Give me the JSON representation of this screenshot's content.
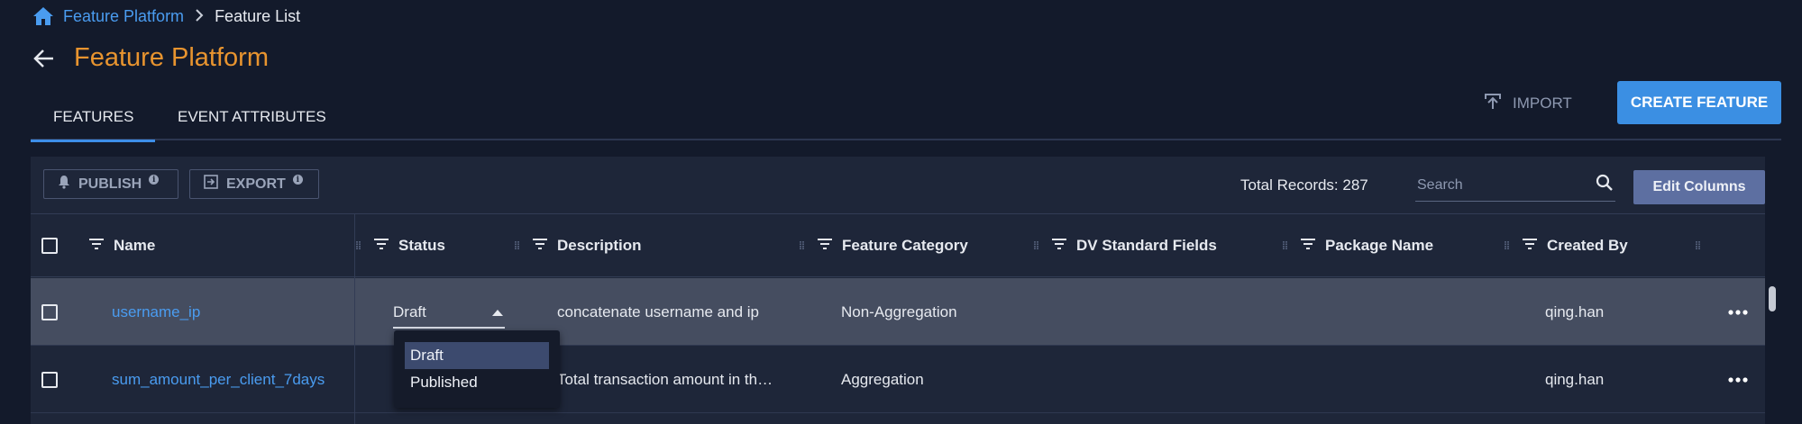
{
  "breadcrumb": {
    "root": "Feature Platform",
    "current": "Feature List"
  },
  "page": {
    "title": "Feature Platform"
  },
  "tabs": [
    {
      "label": "FEATURES",
      "active": true
    },
    {
      "label": "EVENT ATTRIBUTES",
      "active": false
    }
  ],
  "actions": {
    "import_label": "IMPORT",
    "create_label": "CREATE FEATURE"
  },
  "toolbar": {
    "publish_label": "PUBLISH",
    "export_label": "EXPORT",
    "total_records": "Total Records: 287",
    "search_placeholder": "Search",
    "edit_columns_label": "Edit Columns"
  },
  "table": {
    "columns": [
      "Name",
      "Status",
      "Description",
      "Feature Category",
      "DV Standard Fields",
      "Package Name",
      "Created By"
    ],
    "rows": [
      {
        "name": "username_ip",
        "status": "Draft",
        "description": "concatenate username and ip",
        "category": "Non-Aggregation",
        "dv_fields": "",
        "package": "",
        "created_by": "qing.han"
      },
      {
        "name": "sum_amount_per_client_7days",
        "status": "",
        "description": "Total transaction amount in th…",
        "category": "Aggregation",
        "dv_fields": "",
        "package": "",
        "created_by": "qing.han"
      }
    ]
  },
  "status_dropdown": {
    "options": [
      "Draft",
      "Published"
    ],
    "selected": "Draft"
  },
  "colors": {
    "accent": "#3b8fe3",
    "title": "#e8942f",
    "link": "#4a9cf0",
    "background": "#131a2b",
    "panel": "#1e2639"
  },
  "icons": [
    "home-icon",
    "chevron-right-icon",
    "back-arrow-icon",
    "upload-icon",
    "bell-icon",
    "export-icon",
    "info-icon",
    "search-icon",
    "filter-icon",
    "drag-handle-icon",
    "more-icon",
    "caret-up-icon"
  ]
}
